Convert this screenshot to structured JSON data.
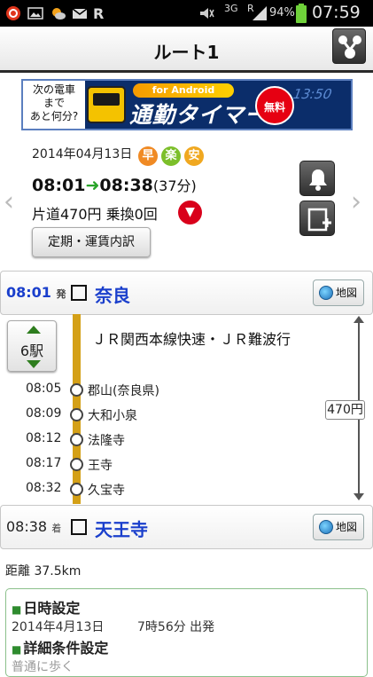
{
  "status_bar": {
    "network": "3G",
    "roaming": "R",
    "battery": "94%",
    "clock": "07:59"
  },
  "header": {
    "title": "ルート1",
    "share_icon": "share-icon"
  },
  "banner": {
    "line1": "次の電車",
    "line2": "まで",
    "line3": "あと何分?",
    "platform": "for Android",
    "product": "通勤タイマー",
    "free": "無料",
    "digits": "13:50"
  },
  "route": {
    "date": "2014年04月13日",
    "badges": [
      {
        "label": "早",
        "color": "#f08a24"
      },
      {
        "label": "楽",
        "color": "#7cbf2a"
      },
      {
        "label": "安",
        "color": "#f0a820"
      }
    ],
    "depart": "08:01",
    "arrive": "08:38",
    "duration": "(37分)",
    "fare_summary": "片道470円 乗換0回",
    "fare_detail_button": "定期・運賃内訳"
  },
  "origin": {
    "time": "08:01",
    "suffix": "発",
    "name": "奈良",
    "map": "地図"
  },
  "segment": {
    "stations_count": "6駅",
    "line": "ＪＲ関西本線快速・ＪＲ難波行",
    "fare": "470円",
    "stops": [
      {
        "time": "08:05",
        "name": "郡山(奈良県)"
      },
      {
        "time": "08:09",
        "name": "大和小泉"
      },
      {
        "time": "08:12",
        "name": "法隆寺"
      },
      {
        "time": "08:17",
        "name": "王寺"
      },
      {
        "time": "08:32",
        "name": "久宝寺"
      }
    ]
  },
  "destination": {
    "time": "08:38",
    "suffix": "着",
    "name": "天王寺",
    "map": "地図"
  },
  "distance": "距離 37.5km",
  "settings": {
    "datetime_heading": "日時設定",
    "datetime_date": "2014年4月13日",
    "datetime_time": "7時56分 出発",
    "detail_heading": "詳細条件設定",
    "detail_value": "普通に歩く"
  }
}
